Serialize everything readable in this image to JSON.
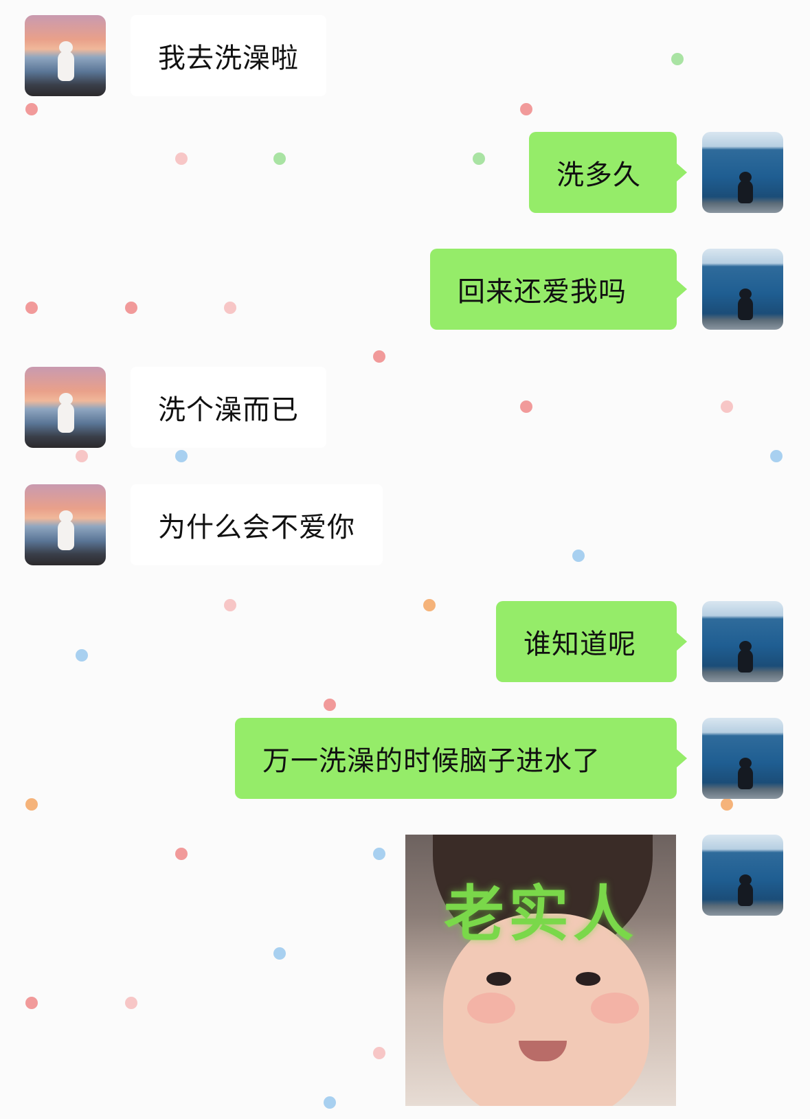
{
  "colors": {
    "background": "#fbfbfb",
    "received_bubble": "#ffffff",
    "sent_bubble": "#95ec69",
    "sticker_text": "#7ad84a"
  },
  "messages": [
    {
      "side": "left",
      "text": "我去洗澡啦",
      "avatar": "sunset-cat-avatar"
    },
    {
      "side": "right",
      "text": "洗多久",
      "avatar": "ocean-cat-avatar"
    },
    {
      "side": "right",
      "text": "回来还爱我吗",
      "avatar": "ocean-cat-avatar"
    },
    {
      "side": "left",
      "text": "洗个澡而已",
      "avatar": "sunset-cat-avatar"
    },
    {
      "side": "left",
      "text": "为什么会不爱你",
      "avatar": "sunset-cat-avatar"
    },
    {
      "side": "right",
      "text": "谁知道呢",
      "avatar": "ocean-cat-avatar"
    },
    {
      "side": "right",
      "text": "万一洗澡的时候脑子进水了",
      "avatar": "ocean-cat-avatar"
    },
    {
      "side": "right",
      "type": "sticker",
      "text": "老实人",
      "avatar": "ocean-cat-avatar"
    }
  ]
}
